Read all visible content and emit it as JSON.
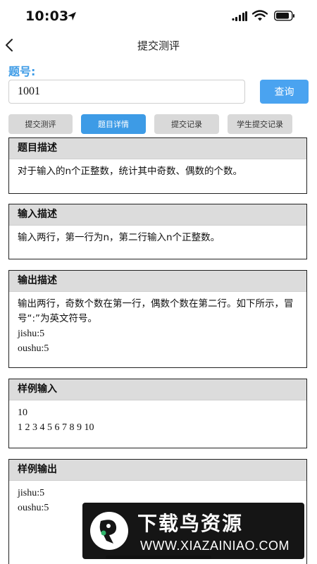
{
  "status_bar": {
    "time": "10:03"
  },
  "nav": {
    "title": "提交测评"
  },
  "query": {
    "label": "题号:",
    "value": "1001",
    "button_label": "查询"
  },
  "tabs": [
    {
      "label": "提交测评",
      "active": false
    },
    {
      "label": "题目详情",
      "active": true
    },
    {
      "label": "提交记录",
      "active": false
    },
    {
      "label": "学生提交记录",
      "active": false
    }
  ],
  "sections": {
    "description": {
      "title": "题目描述",
      "text": "对于输入的n个正整数，统计其中奇数、偶数的个数。"
    },
    "input": {
      "title": "输入描述",
      "text": "输入两行，第一行为n，第二行输入n个正整数。"
    },
    "output": {
      "title": "输出描述",
      "text": "输出两行，奇数个数在第一行，偶数个数在第二行。如下所示，冒号“:”为英文符号。",
      "lines": [
        "jishu:5",
        "oushu:5"
      ]
    },
    "sample_input": {
      "title": "样例输入",
      "lines": [
        "10",
        "1 2 3 4 5 6 7 8 9 10"
      ]
    },
    "sample_output": {
      "title": "样例输出",
      "lines": [
        "jishu:5",
        "oushu:5"
      ]
    }
  },
  "colors": {
    "accent": "#3d9be6",
    "tab_inactive": "#d9d9d9",
    "section_header": "#dcdcdc"
  },
  "watermark": {
    "title": "下载鸟资源",
    "url": "WWW.XIAZAINIAO.COM"
  }
}
